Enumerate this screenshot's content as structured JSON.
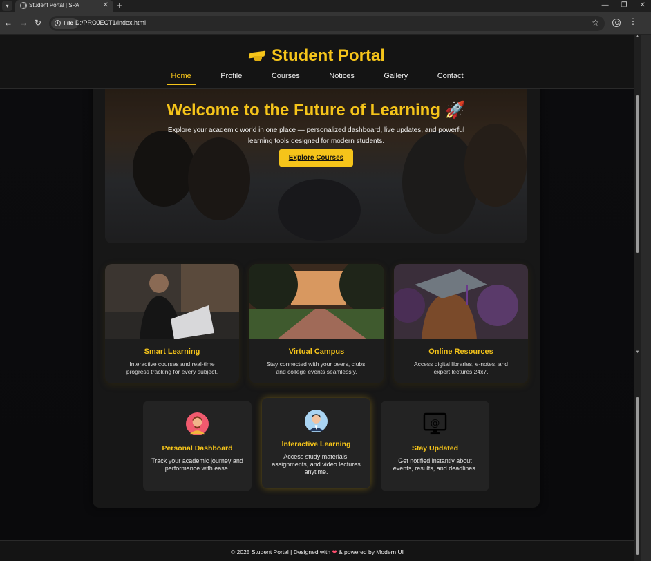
{
  "browser": {
    "tab_title": "Student Portal | SPA",
    "site_chip": "File",
    "url": "D:/PROJECT1/index.html"
  },
  "header": {
    "brand": "Student Portal",
    "nav": [
      "Home",
      "Profile",
      "Courses",
      "Notices",
      "Gallery",
      "Contact"
    ],
    "active_nav": "Home"
  },
  "hero": {
    "title": "Welcome to the Future of Learning 🚀",
    "subtitle": "Explore your academic world in one place — personalized dashboard, live updates, and powerful learning tools designed for modern students.",
    "cta": "Explore Courses"
  },
  "features": [
    {
      "title": "Smart Learning",
      "desc": "Interactive courses and real-time progress tracking for every subject."
    },
    {
      "title": "Virtual Campus",
      "desc": "Stay connected with your peers, clubs, and college events seamlessly."
    },
    {
      "title": "Online Resources",
      "desc": "Access digital libraries, e-notes, and expert lectures 24x7."
    }
  ],
  "info_cards": [
    {
      "title": "Personal Dashboard",
      "desc": "Track your academic journey and performance with ease.",
      "icon": "user-avatar-icon"
    },
    {
      "title": "Interactive Learning",
      "desc": "Access study materials, assignments, and video lectures anytime.",
      "icon": "teacher-avatar-icon"
    },
    {
      "title": "Stay Updated",
      "desc": "Get notified instantly about events, results, and deadlines.",
      "icon": "email-monitor-icon"
    }
  ],
  "footer": {
    "before": "© 2025 Student Portal | Designed with",
    "heart": "❤",
    "after": "& powered by Modern UI"
  },
  "colors": {
    "accent": "#f5c41a",
    "background": "#0d0d0d",
    "card": "#232323"
  }
}
